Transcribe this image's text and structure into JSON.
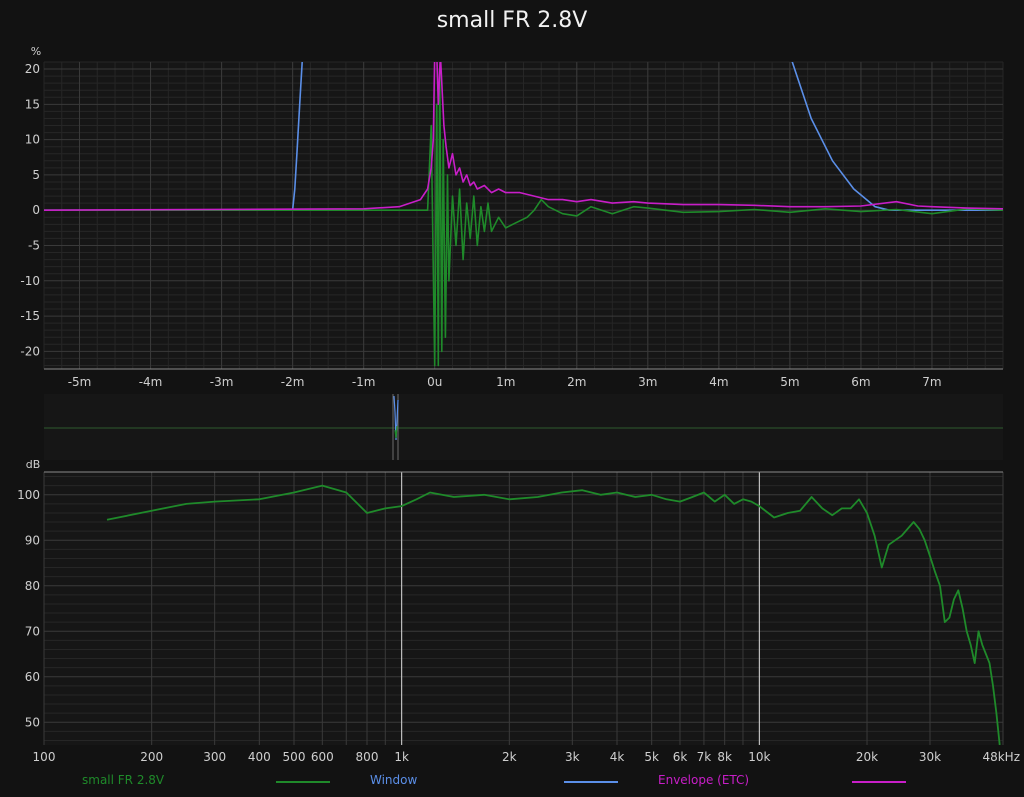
{
  "title": "small FR 2.8V",
  "colors": {
    "background": "#121212",
    "panel": "#161616",
    "grid": "#3a3a3a",
    "grid_minor": "#262626",
    "measurement": "#1f8a2a",
    "window": "#5b8fe8",
    "envelope": "#c81ec8",
    "marker": "#d8d8d8"
  },
  "legend": [
    {
      "label": "small FR 2.8V",
      "color": "#1f8a2a"
    },
    {
      "label": "Window",
      "color": "#5b8fe8"
    },
    {
      "label": "Envelope (ETC)",
      "color": "#c81ec8"
    }
  ],
  "chart_data": [
    {
      "type": "line",
      "name": "impulse",
      "ylabel": "%",
      "xlim": [
        -5.5,
        8.0
      ],
      "ylim": [
        -22.5,
        21.0
      ],
      "x_ticks": [
        -5,
        -4,
        -3,
        -2,
        -1,
        0,
        1,
        2,
        3,
        4,
        5,
        6,
        7
      ],
      "x_tick_labels": [
        "-5m",
        "-4m",
        "-3m",
        "-2m",
        "-1m",
        "0u",
        "1m",
        "2m",
        "3m",
        "4m",
        "5m",
        "6m",
        "7m"
      ],
      "y_ticks": [
        20,
        15,
        10,
        5,
        0,
        -5,
        -10,
        -15,
        -20
      ],
      "y_tick_labels": [
        "20",
        "15",
        "10",
        "5",
        "0",
        "-5",
        "-10",
        "-15",
        "-20"
      ],
      "series": [
        {
          "name": "small FR 2.8V",
          "role": "impulse",
          "color": "#1f8a2a",
          "x": [
            -5.5,
            -0.5,
            -0.1,
            -0.05,
            0.0,
            0.03,
            0.05,
            0.07,
            0.1,
            0.12,
            0.15,
            0.18,
            0.2,
            0.25,
            0.3,
            0.35,
            0.4,
            0.45,
            0.5,
            0.55,
            0.6,
            0.65,
            0.7,
            0.75,
            0.8,
            0.9,
            1.0,
            1.1,
            1.2,
            1.3,
            1.4,
            1.5,
            1.6,
            1.8,
            2.0,
            2.2,
            2.5,
            2.8,
            3.0,
            3.5,
            4.0,
            4.5,
            5.0,
            5.5,
            6.0,
            6.5,
            7.0,
            7.5,
            8.0
          ],
          "y": [
            0,
            0,
            0,
            12,
            -22,
            15,
            -22,
            20,
            -20,
            10,
            -18,
            5,
            -10,
            2,
            -5,
            3,
            -7,
            1,
            -4,
            2,
            -5,
            0.5,
            -3,
            1,
            -3,
            -1,
            -2.5,
            -2,
            -1.5,
            -1,
            0,
            1.5,
            0.5,
            -0.5,
            -0.8,
            0.5,
            -0.5,
            0.5,
            0.3,
            -0.3,
            -0.2,
            0.1,
            -0.3,
            0.2,
            -0.2,
            0.1,
            -0.5,
            0.2,
            0
          ]
        },
        {
          "name": "Window",
          "role": "window",
          "color": "#5b8fe8",
          "x": [
            -5.5,
            -2.0,
            -1.97,
            -1.94,
            -1.9,
            -1.86,
            5.0,
            5.3,
            5.6,
            5.9,
            6.2,
            6.4,
            8.0
          ],
          "y": [
            0,
            0,
            3,
            8,
            15,
            22,
            22,
            13,
            7,
            3,
            0.5,
            0,
            0
          ]
        },
        {
          "name": "Envelope (ETC)",
          "role": "envelope",
          "color": "#c81ec8",
          "x": [
            -5.5,
            -1.0,
            -0.5,
            -0.2,
            -0.1,
            -0.05,
            -0.02,
            0.0,
            0.03,
            0.05,
            0.08,
            0.1,
            0.13,
            0.16,
            0.2,
            0.25,
            0.3,
            0.35,
            0.4,
            0.45,
            0.5,
            0.55,
            0.6,
            0.7,
            0.8,
            0.9,
            1.0,
            1.2,
            1.4,
            1.6,
            1.8,
            2.0,
            2.2,
            2.5,
            2.8,
            3.0,
            3.5,
            4.0,
            4.5,
            5.0,
            5.5,
            6.0,
            6.5,
            6.8,
            7.0,
            7.5,
            8.0
          ],
          "y": [
            0,
            0.2,
            0.5,
            1.5,
            3,
            6,
            10,
            22,
            22,
            15,
            22,
            18,
            12,
            9,
            6,
            8,
            5,
            6,
            4,
            5,
            3.5,
            4,
            3,
            3.5,
            2.5,
            3,
            2.5,
            2.5,
            2,
            1.5,
            1.5,
            1.2,
            1.5,
            1,
            1.2,
            1,
            0.8,
            0.8,
            0.7,
            0.5,
            0.5,
            0.6,
            1.2,
            0.6,
            0.5,
            0.3,
            0.2
          ]
        }
      ]
    },
    {
      "type": "line",
      "name": "frequency response",
      "ylabel": "dB",
      "xscale": "log",
      "xlim": [
        100,
        48000
      ],
      "ylim": [
        45,
        105
      ],
      "x_ticks": [
        100,
        200,
        300,
        400,
        500,
        600,
        800,
        1000,
        2000,
        3000,
        4000,
        5000,
        6000,
        7000,
        8000,
        10000,
        20000,
        30000,
        48000
      ],
      "x_tick_labels": [
        "100",
        "200",
        "300",
        "400",
        "500",
        "600",
        "800",
        "1k",
        "2k",
        "3k",
        "4k",
        "5k",
        "6k",
        "7k",
        "8k",
        "10k",
        "20k",
        "30k",
        "48kHz"
      ],
      "y_ticks": [
        100,
        90,
        80,
        70,
        60,
        50
      ],
      "y_tick_labels": [
        "100",
        "90",
        "80",
        "70",
        "60",
        "50"
      ],
      "markers_hz": [
        1000,
        10000
      ],
      "series": [
        {
          "name": "small FR 2.8V",
          "color": "#1f8a2a",
          "x": [
            150,
            200,
            250,
            300,
            400,
            500,
            600,
            700,
            800,
            900,
            1000,
            1100,
            1200,
            1400,
            1700,
            2000,
            2400,
            2800,
            3200,
            3600,
            4000,
            4500,
            5000,
            5500,
            6000,
            6500,
            7000,
            7500,
            8000,
            8500,
            9000,
            9500,
            10000,
            11000,
            12000,
            13000,
            14000,
            15000,
            16000,
            17000,
            18000,
            19000,
            20000,
            21000,
            22000,
            23000,
            25000,
            27000,
            28000,
            29000,
            30000,
            31000,
            32000,
            33000,
            34000,
            35000,
            36000,
            37000,
            38000,
            39000,
            40000,
            41000,
            42000,
            43000,
            44000,
            45000,
            46000,
            47000
          ],
          "y": [
            94.5,
            96.5,
            98,
            98.5,
            99,
            100.5,
            102,
            100.5,
            96,
            97,
            97.5,
            99,
            100.5,
            99.5,
            100,
            99,
            99.5,
            100.5,
            101,
            100,
            100.5,
            99.5,
            100,
            99,
            98.5,
            99.5,
            100.5,
            98.5,
            100,
            98,
            99,
            98.5,
            97.5,
            95,
            96,
            96.5,
            99.5,
            97,
            95.5,
            97,
            97,
            99,
            96,
            91,
            84,
            89,
            91,
            94,
            92.5,
            90,
            86.5,
            83,
            80,
            72,
            73,
            77,
            79,
            75,
            70,
            67,
            63,
            70,
            67,
            65,
            63,
            58,
            52,
            45
          ]
        }
      ]
    }
  ]
}
